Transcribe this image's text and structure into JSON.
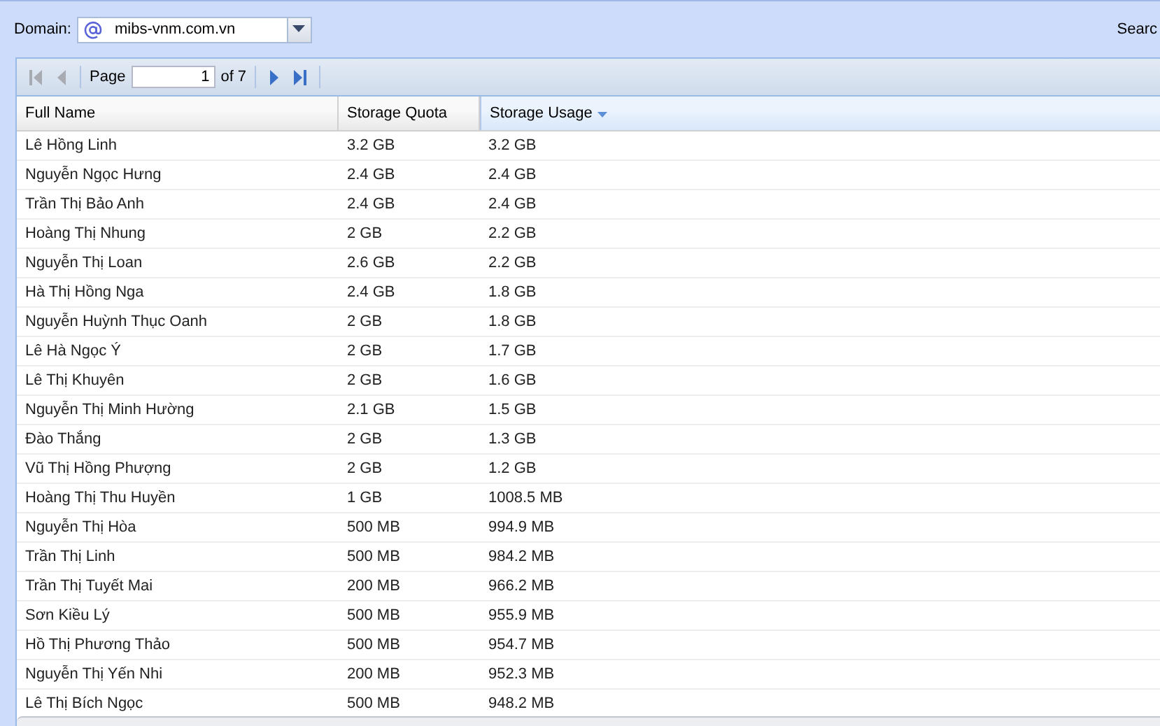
{
  "domain": {
    "label": "Domain:",
    "value": "mibs-vnm.com.vn"
  },
  "search": {
    "label": "Searc"
  },
  "pager": {
    "page_label": "Page",
    "page": "1",
    "of": "of 7",
    "buttons": [
      {
        "kind": "first",
        "disabled": true
      },
      {
        "kind": "prev",
        "disabled": true
      },
      {
        "kind": "next",
        "disabled": false
      },
      {
        "kind": "last",
        "disabled": false
      }
    ]
  },
  "table": {
    "columns": [
      {
        "label": "Full Name",
        "sorted": false
      },
      {
        "label": "Storage Quota",
        "sorted": false
      },
      {
        "label": "Storage Usage",
        "sorted": true
      }
    ],
    "rows": [
      [
        "Lê Hồng Linh",
        "3.2 GB",
        "3.2 GB"
      ],
      [
        "Nguyễn Ngọc Hưng",
        "2.4 GB",
        "2.4 GB"
      ],
      [
        "Trần Thị Bảo Anh",
        "2.4 GB",
        "2.4 GB"
      ],
      [
        "Hoàng Thị Nhung",
        "2 GB",
        "2.2 GB"
      ],
      [
        "Nguyễn Thị Loan",
        "2.6 GB",
        "2.2 GB"
      ],
      [
        "Hà Thị Hồng Nga",
        "2.4 GB",
        "1.8 GB"
      ],
      [
        "Nguyễn Huỳnh Thục Oanh",
        "2 GB",
        "1.8 GB"
      ],
      [
        "Lê Hà Ngọc Ý",
        "2 GB",
        "1.7 GB"
      ],
      [
        "Lê Thị Khuyên",
        "2 GB",
        "1.6 GB"
      ],
      [
        "Nguyễn Thị Minh Hường",
        "2.1 GB",
        "1.5 GB"
      ],
      [
        "Đào Thắng",
        "2 GB",
        "1.3 GB"
      ],
      [
        "Vũ Thị Hồng Phượng",
        "2 GB",
        "1.2 GB"
      ],
      [
        "Hoàng Thị Thu Huyền",
        "1 GB",
        "1008.5 MB"
      ],
      [
        "Nguyễn Thị Hòa",
        "500 MB",
        "994.9 MB"
      ],
      [
        "Trần Thị Linh",
        "500 MB",
        "984.2 MB"
      ],
      [
        "Trần Thị Tuyết Mai",
        "200 MB",
        "966.2 MB"
      ],
      [
        "Sơn Kiều Lý",
        "500 MB",
        "955.9 MB"
      ],
      [
        "Hồ Thị Phương Thảo",
        "500 MB",
        "954.7 MB"
      ],
      [
        "Nguyễn Thị Yến Nhi",
        "200 MB",
        "952.3 MB"
      ],
      [
        "Lê Thị Bích Ngọc",
        "500 MB",
        "948.2 MB"
      ]
    ]
  }
}
